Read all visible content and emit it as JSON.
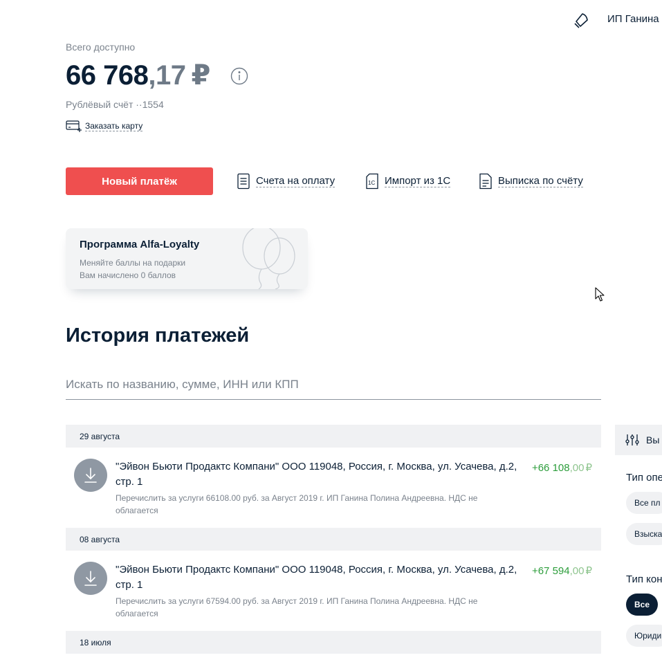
{
  "header": {
    "bell_icon": "bell-icon",
    "user_name": "ИП Ганина"
  },
  "account": {
    "available_label": "Всего доступно",
    "balance_integer": "66 768",
    "balance_fraction": ",17",
    "currency": "₽",
    "account_line": "Рублёвый счёт ··1554",
    "order_card_label": "Заказать карту"
  },
  "actions": {
    "new_payment": "Новый платёж",
    "invoices": "Счета на оплату",
    "import_1c": "Импорт из 1С",
    "statement": "Выписка по счёту"
  },
  "loyalty": {
    "title": "Программа Alfa-Loyalty",
    "line1": "Меняйте баллы на подарки",
    "line2": "Вам начислено 0 баллов"
  },
  "history": {
    "title": "История платежей",
    "search_placeholder": "Искать по названию, сумме, ИНН или КПП",
    "groups": [
      {
        "date": "29 августа",
        "transaction": {
          "icon": "incoming-arrow-icon",
          "title": "\"Эйвон Бьюти Продактс Компани\" ООО 119048, Россия, г. Москва, ул. Усачева, д.2, стр. 1",
          "description": "Перечислить за услуги 66108.00 руб. за Август 2019 г. ИП Ганина Полина Андреевна. НДС не облагается",
          "amount_integer": "+66 108",
          "amount_fraction": ",00",
          "currency": "₽"
        }
      },
      {
        "date": "08 августа",
        "transaction": {
          "icon": "incoming-arrow-icon",
          "title": "\"Эйвон Бьюти Продактс Компани\" ООО 119048, Россия, г. Москва, ул. Усачева, д.2, стр. 1",
          "description": "Перечислить за услуги 67594.00 руб. за Август 2019 г. ИП Ганина Полина Андреевна. НДС не облагается",
          "amount_integer": "+67 594",
          "amount_fraction": ",00",
          "currency": "₽"
        }
      },
      {
        "date": "18 июля"
      }
    ]
  },
  "filters": {
    "panel_label": "Вы",
    "operation_type_label": "Тип опе",
    "operation_chips": [
      "Все пл",
      "Взыска"
    ],
    "counterparty_type_label": "Тип кон",
    "counterparty_chips": [
      "Все",
      "Юриди"
    ]
  },
  "colors": {
    "brand_red": "#ef4f4f",
    "text_dark": "#0b1f35",
    "text_muted": "#7a828c",
    "positive_green": "#2c9d3b",
    "surface_gray": "#f0f1f3"
  }
}
